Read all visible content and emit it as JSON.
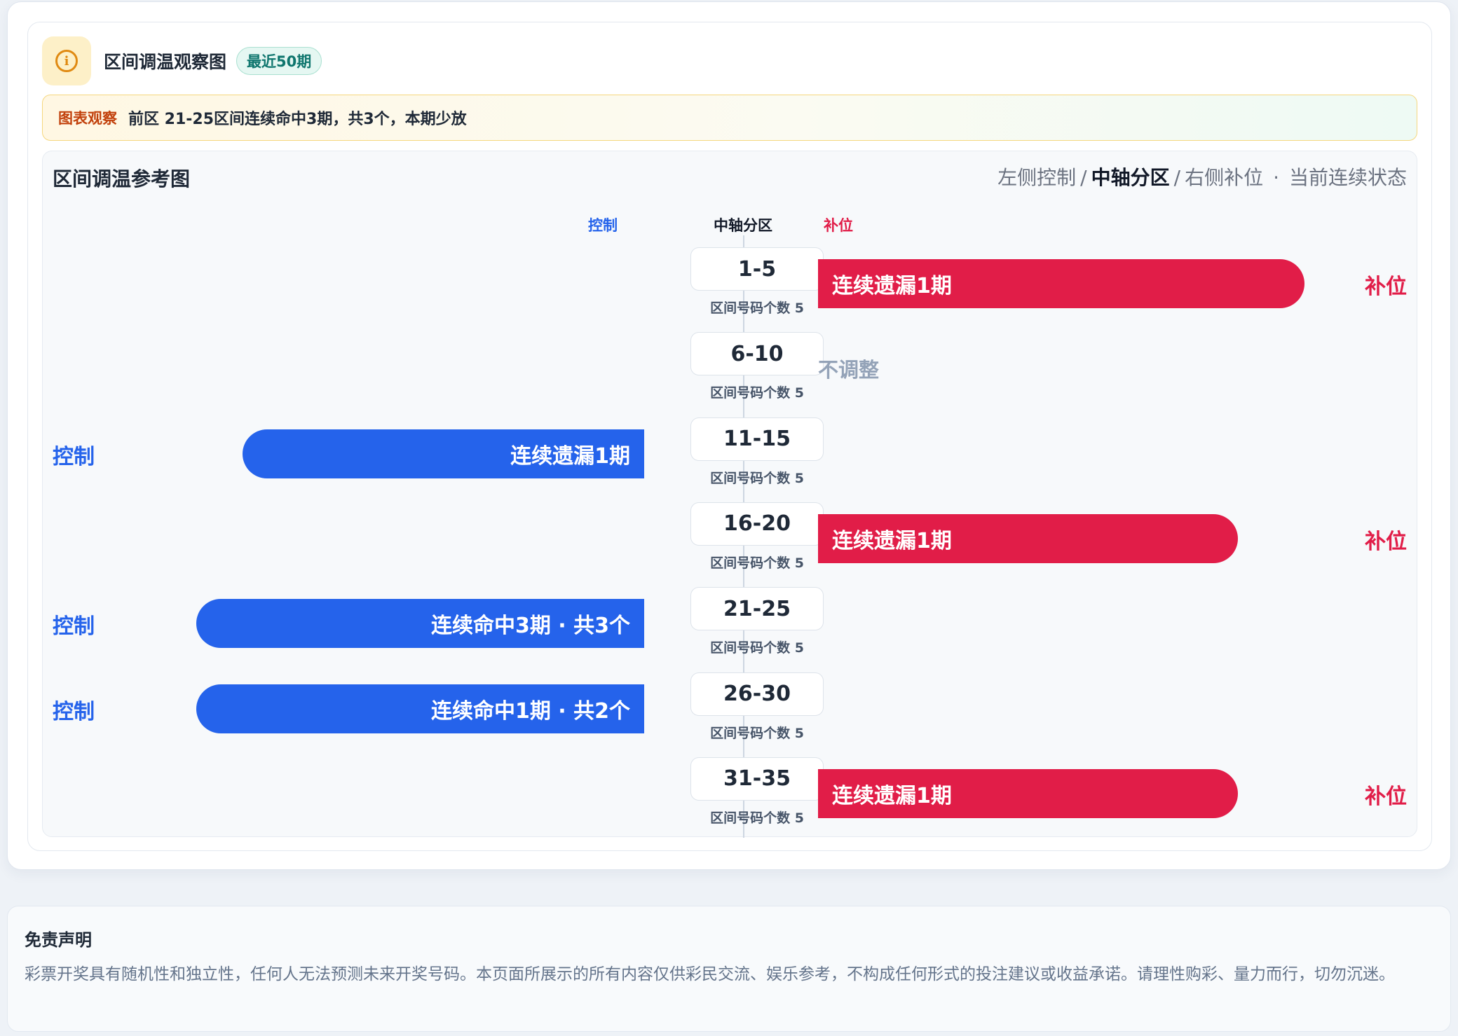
{
  "header": {
    "title": "区间调温观察图",
    "badge": "最近50期",
    "icon": "info-icon"
  },
  "observation": {
    "label": "图表观察",
    "text": "前区 21-25区间连续命中3期，共3个，本期少放"
  },
  "chart": {
    "title": "区间调温参考图",
    "legend": {
      "left": "左侧控制",
      "sep1": "/",
      "center": "中轴分区",
      "sep2": "/",
      "right": "右侧补位",
      "dot": "·",
      "state": "当前连续状态"
    },
    "col_control": "控制",
    "col_axis": "中轴分区",
    "col_fill": "补位"
  },
  "chart_data": {
    "type": "bar",
    "categories": [
      "1-5",
      "6-10",
      "11-15",
      "16-20",
      "21-25",
      "26-30",
      "31-35"
    ],
    "count_label": "区间号码个数 5",
    "rows": [
      {
        "zone": "1-5",
        "count_text": "区间号码个数 5",
        "side": "fill",
        "bar_text": "连续遗漏1期",
        "bar_length": 0.87,
        "side_text": "补位"
      },
      {
        "zone": "6-10",
        "count_text": "区间号码个数 5",
        "side": "none",
        "bar_text": "不调整"
      },
      {
        "zone": "11-15",
        "count_text": "区间号码个数 5",
        "side": "control",
        "bar_text": "连续遗漏1期",
        "bar_length": 0.78,
        "side_text": "控制"
      },
      {
        "zone": "16-20",
        "count_text": "区间号码个数 5",
        "side": "fill",
        "bar_text": "连续遗漏1期",
        "bar_length": 0.75,
        "side_text": "补位"
      },
      {
        "zone": "21-25",
        "count_text": "区间号码个数 5",
        "side": "control",
        "bar_text": "连续命中3期 · 共3个",
        "bar_length": 0.87,
        "side_text": "控制"
      },
      {
        "zone": "26-30",
        "count_text": "区间号码个数 5",
        "side": "control",
        "bar_text": "连续命中1期 · 共2个",
        "bar_length": 0.87,
        "side_text": "控制"
      },
      {
        "zone": "31-35",
        "count_text": "区间号码个数 5",
        "side": "fill",
        "bar_text": "连续遗漏1期",
        "bar_length": 0.75,
        "side_text": "补位"
      }
    ],
    "colors": {
      "control": "#2563eb",
      "fill": "#e11d48",
      "neutral": "#94a3b8"
    }
  },
  "disclaimer": {
    "title": "免责声明",
    "text": "彩票开奖具有随机性和独立性，任何人无法预测未来开奖号码。本页面所展示的所有内容仅供彩民交流、娱乐参考，不构成任何形式的投注建议或收益承诺。请理性购彩、量力而行，切勿沉迷。"
  }
}
